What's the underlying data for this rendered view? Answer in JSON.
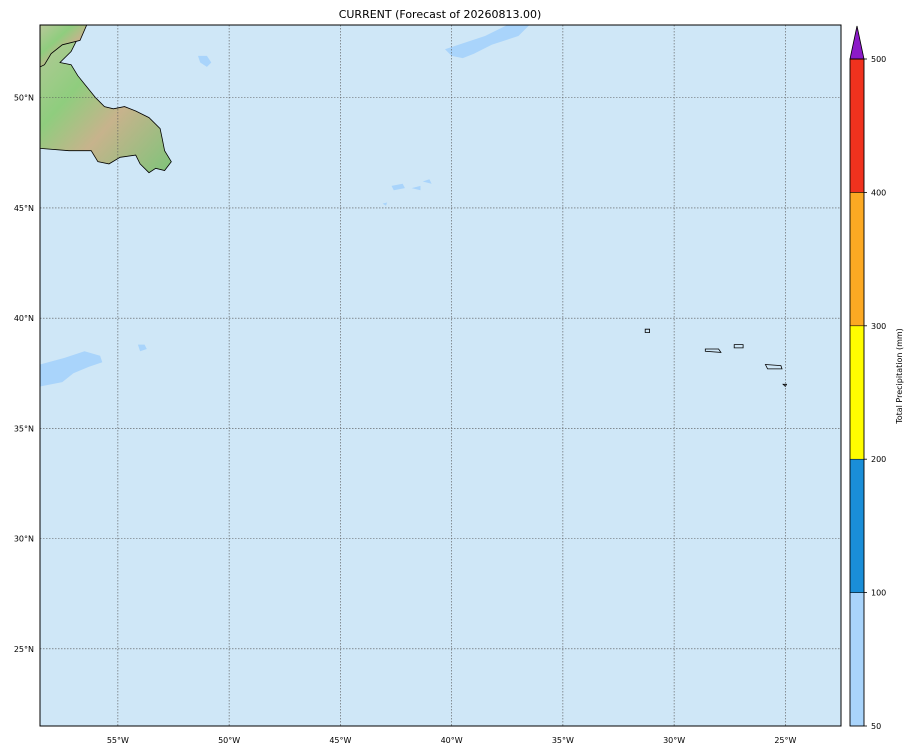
{
  "map": {
    "title": "CURRENT (Forecast of 20260813.00)",
    "projection": "cylindrical",
    "lon_range": [
      -58.5,
      -22.5
    ],
    "lat_range": [
      21.5,
      53.3
    ],
    "ocean_color": "#cfe7f7",
    "lake_color": "#a9d4fb",
    "grid_lons": [
      -55,
      -50,
      -45,
      -40,
      -35,
      -30,
      -25
    ],
    "grid_lats": [
      25,
      30,
      35,
      40,
      45,
      50
    ],
    "lon_labels": [
      "55°W",
      "50°W",
      "45°W",
      "40°W",
      "35°W",
      "30°W",
      "25°W"
    ],
    "lat_labels": [
      "25°N",
      "30°N",
      "35°N",
      "40°N",
      "45°N",
      "50°N"
    ],
    "landmasses": [
      {
        "name": "newfoundland",
        "color": "#9fcf82",
        "points": [
          [
            -58.5,
            53.2
          ],
          [
            -57.3,
            53.3
          ],
          [
            -56.8,
            52.7
          ],
          [
            -57.1,
            52.1
          ],
          [
            -57.6,
            51.6
          ],
          [
            -57.1,
            51.5
          ],
          [
            -56.8,
            51.0
          ],
          [
            -56.4,
            50.5
          ],
          [
            -56.0,
            50.0
          ],
          [
            -55.6,
            49.6
          ],
          [
            -55.2,
            49.5
          ],
          [
            -54.7,
            49.6
          ],
          [
            -54.2,
            49.4
          ],
          [
            -53.6,
            49.1
          ],
          [
            -53.1,
            48.6
          ],
          [
            -53.0,
            48.1
          ],
          [
            -52.9,
            47.6
          ],
          [
            -52.6,
            47.1
          ],
          [
            -52.9,
            46.7
          ],
          [
            -53.3,
            46.8
          ],
          [
            -53.6,
            46.6
          ],
          [
            -54.0,
            47.0
          ],
          [
            -54.2,
            47.4
          ],
          [
            -54.9,
            47.3
          ],
          [
            -55.4,
            47.0
          ],
          [
            -55.9,
            47.1
          ],
          [
            -56.2,
            47.6
          ],
          [
            -57.2,
            47.6
          ],
          [
            -58.5,
            47.7
          ]
        ]
      },
      {
        "name": "labrador",
        "color": "#a8cf8b",
        "points": [
          [
            -58.5,
            53.3
          ],
          [
            -58.5,
            51.4
          ],
          [
            -58.3,
            51.5
          ],
          [
            -58.0,
            52.0
          ],
          [
            -57.5,
            52.4
          ],
          [
            -56.7,
            52.6
          ],
          [
            -56.4,
            53.3
          ]
        ]
      }
    ],
    "lakes": [
      {
        "name": "north-bank",
        "points": [
          [
            -40.3,
            52.2
          ],
          [
            -38.5,
            52.8
          ],
          [
            -37.5,
            53.3
          ],
          [
            -36.5,
            53.3
          ],
          [
            -37.0,
            52.8
          ],
          [
            -38.2,
            52.4
          ],
          [
            -39.0,
            52.0
          ],
          [
            -39.5,
            51.8
          ],
          [
            -40.0,
            51.9
          ]
        ]
      },
      {
        "name": "nw-blob",
        "points": [
          [
            -51.4,
            51.9
          ],
          [
            -51.0,
            51.9
          ],
          [
            -50.8,
            51.6
          ],
          [
            -51.0,
            51.4
          ],
          [
            -51.3,
            51.6
          ]
        ]
      },
      {
        "name": "west-shelf",
        "points": [
          [
            -58.5,
            36.9
          ],
          [
            -57.5,
            37.1
          ],
          [
            -57.0,
            37.5
          ],
          [
            -56.3,
            37.8
          ],
          [
            -55.7,
            38.0
          ],
          [
            -55.8,
            38.3
          ],
          [
            -56.5,
            38.5
          ],
          [
            -57.4,
            38.2
          ],
          [
            -58.5,
            37.9
          ]
        ]
      },
      {
        "name": "small-blob",
        "points": [
          [
            -54.1,
            38.8
          ],
          [
            -53.8,
            38.8
          ],
          [
            -53.7,
            38.6
          ],
          [
            -54.0,
            38.5
          ]
        ]
      }
    ],
    "islands": [
      {
        "name": "azores-flores",
        "points": [
          [
            -31.3,
            39.5
          ],
          [
            -31.1,
            39.5
          ],
          [
            -31.1,
            39.35
          ],
          [
            -31.3,
            39.35
          ]
        ]
      },
      {
        "name": "azores-faial-pico",
        "points": [
          [
            -28.6,
            38.6
          ],
          [
            -28.0,
            38.6
          ],
          [
            -27.9,
            38.45
          ],
          [
            -28.6,
            38.5
          ]
        ]
      },
      {
        "name": "azores-terceira",
        "points": [
          [
            -27.3,
            38.8
          ],
          [
            -26.9,
            38.8
          ],
          [
            -26.9,
            38.65
          ],
          [
            -27.3,
            38.65
          ]
        ]
      },
      {
        "name": "azores-sao-miguel",
        "points": [
          [
            -25.9,
            37.9
          ],
          [
            -25.2,
            37.85
          ],
          [
            -25.15,
            37.7
          ],
          [
            -25.8,
            37.7
          ]
        ]
      },
      {
        "name": "azores-santa-maria",
        "points": [
          [
            -25.1,
            37.0
          ],
          [
            -24.95,
            37.0
          ],
          [
            -25.0,
            36.9
          ]
        ]
      }
    ],
    "small_patches": [
      {
        "name": "shoal-1",
        "points": [
          [
            -42.7,
            46.0
          ],
          [
            -42.2,
            46.1
          ],
          [
            -42.1,
            45.9
          ],
          [
            -42.6,
            45.8
          ]
        ]
      },
      {
        "name": "shoal-2",
        "points": [
          [
            -41.8,
            45.9
          ],
          [
            -41.4,
            46.0
          ],
          [
            -41.4,
            45.8
          ]
        ]
      },
      {
        "name": "shoal-3",
        "points": [
          [
            -41.3,
            46.2
          ],
          [
            -41.0,
            46.3
          ],
          [
            -40.9,
            46.1
          ]
        ]
      },
      {
        "name": "shoal-4",
        "points": [
          [
            -43.1,
            45.2
          ],
          [
            -42.9,
            45.25
          ],
          [
            -42.95,
            45.1
          ]
        ]
      }
    ]
  },
  "colorbar": {
    "label": "Total Precipitation (mm)",
    "levels": [
      50,
      100,
      200,
      300,
      400,
      500
    ],
    "level_labels": [
      "50",
      "100",
      "200",
      "300",
      "400",
      "500"
    ],
    "colors": [
      "#a9d4fb",
      "#1a8ed8",
      "#fffd00",
      "#fca923",
      "#f0321e"
    ],
    "extend_color": "#8c1ac8"
  }
}
